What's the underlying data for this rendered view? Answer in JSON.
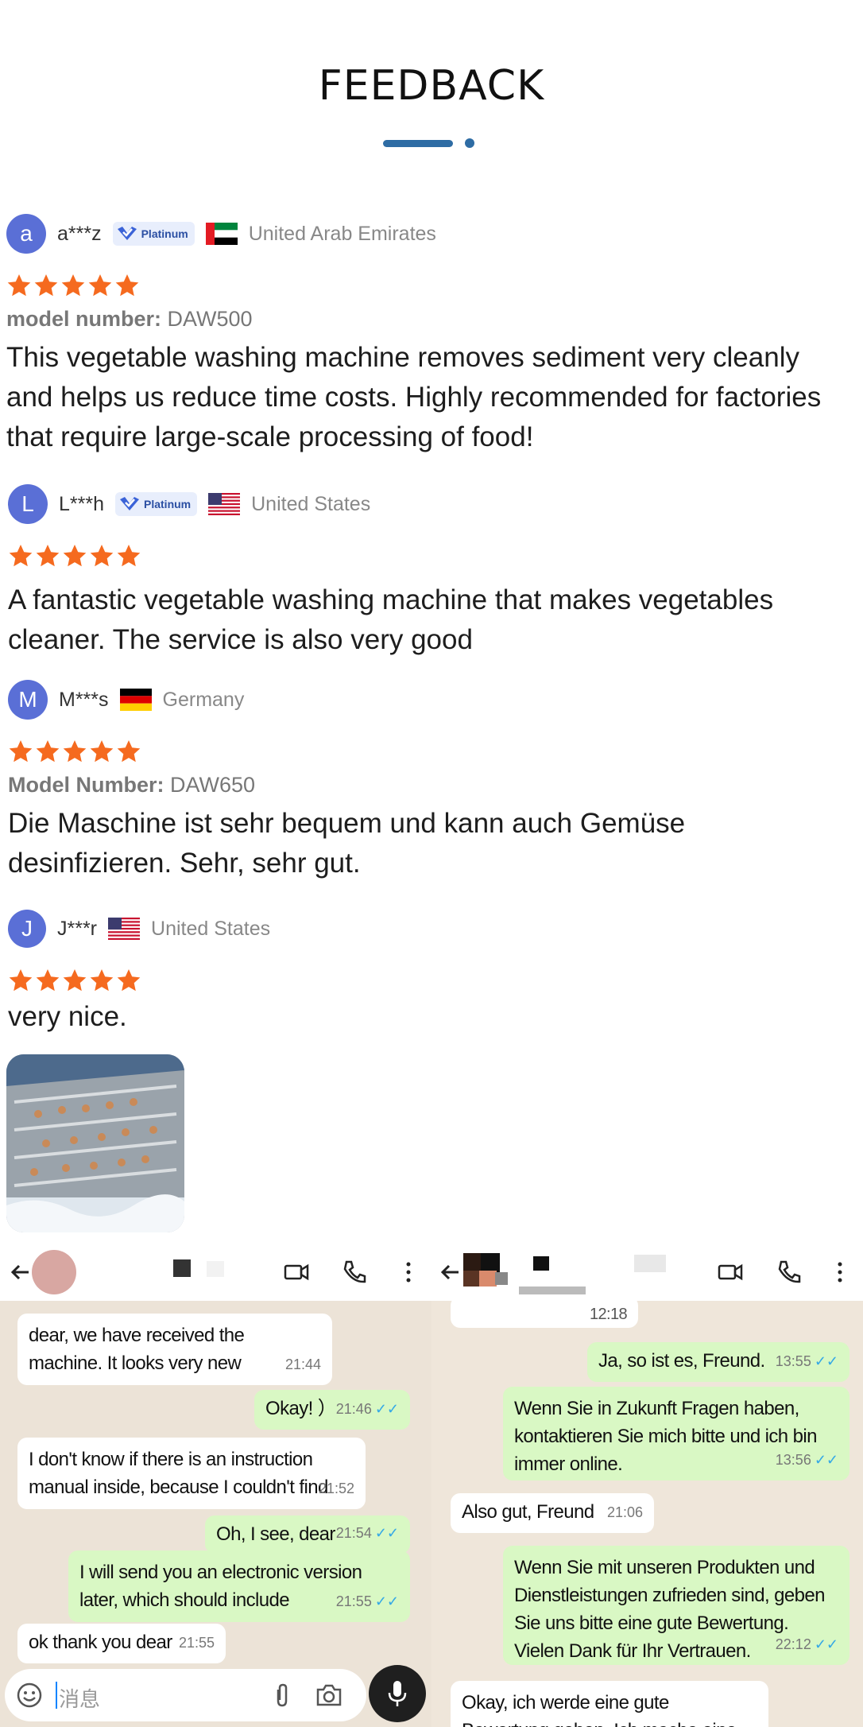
{
  "page_title": "FEEDBACK",
  "reviews": [
    {
      "initial": "a",
      "name": "a***z",
      "badge": "Platinum",
      "country": "United Arab Emirates",
      "flag": "uae-flag",
      "rating": 5,
      "model_label": "model number:",
      "model_value": "DAW500",
      "text": "This vegetable washing machine removes sediment very cleanly and helps us reduce time costs. Highly recommended for factories that require large-scale processing of food!"
    },
    {
      "initial": "L",
      "name": "L***h",
      "badge": "Platinum",
      "country": "United States",
      "flag": "us-flag",
      "rating": 5,
      "text": "A fantastic vegetable washing machine that makes vegetables cleaner. The service is also very good"
    },
    {
      "initial": "M",
      "name": "M***s",
      "country": "Germany",
      "flag": "germany-flag",
      "rating": 5,
      "model_label": "Model Number:",
      "model_value": "DAW650",
      "text": "Die Maschine ist sehr bequem und kann auch Gemüse desinfizieren. Sehr, sehr gut."
    },
    {
      "initial": "J",
      "name": "J***r",
      "country": "United States",
      "flag": "us-flag",
      "rating": 5,
      "text": "very nice."
    }
  ],
  "review_photo": "vegetable-washing-machine-photo",
  "chat_left": {
    "messages": [
      {
        "dir": "in",
        "text": "dear, we have received the machine. It looks very new",
        "time": "21:44"
      },
      {
        "dir": "out",
        "text": "Okay! ）",
        "time": "21:46"
      },
      {
        "dir": "in",
        "text": "I don't know if there is an instruction manual inside, because I couldn't find",
        "time": "21:52"
      },
      {
        "dir": "out",
        "text": "Oh, I see, dear",
        "time": "21:54"
      },
      {
        "dir": "out",
        "text": "I will send you an electronic version later, which should include",
        "time": "21:55"
      },
      {
        "dir": "in",
        "text": "ok thank you dear",
        "time": "21:55"
      }
    ],
    "input_placeholder": "消息"
  },
  "chat_right": {
    "date_chip": "12:18",
    "messages": [
      {
        "dir": "out",
        "text": "Ja, so ist es, Freund.",
        "time": "13:55"
      },
      {
        "dir": "out",
        "text": "Wenn Sie in Zukunft Fragen haben, kontaktieren Sie mich bitte und ich bin immer online.",
        "time": "13:56"
      },
      {
        "dir": "in",
        "text": "Also gut, Freund",
        "time": "21:06"
      },
      {
        "dir": "out",
        "text": "Wenn Sie mit unseren Produkten und Dienstleistungen zufrieden sind, geben Sie uns bitte eine gute Bewertung. Vielen Dank für Ihr Vertrauen.",
        "time": "22:12"
      },
      {
        "dir": "in",
        "text": "Okay, ich werde eine gute Bewertung geben. Ich mache eine andere Bestell",
        "time": ""
      }
    ]
  },
  "icons": {
    "back": "back-arrow-icon",
    "video": "video-call-icon",
    "phone": "phone-icon",
    "menu": "more-vert-icon",
    "emoji": "emoji-icon",
    "attach": "attach-icon",
    "camera": "camera-icon",
    "mic": "mic-icon",
    "star": "star-icon",
    "verified": "verified-check-icon"
  },
  "colors": {
    "accent": "#2e6ca4",
    "star": "#f56a1f",
    "avatar": "#5a6fd6",
    "out_bubble": "#d9f8c4",
    "tick": "#34a8e6"
  }
}
